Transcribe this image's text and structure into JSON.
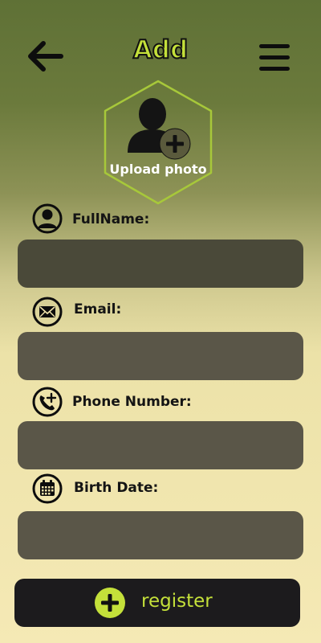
{
  "header": {
    "title": "Add",
    "back_icon": "arrow-left-icon",
    "menu_icon": "hamburger-menu-icon"
  },
  "upload": {
    "label": "Upload photo",
    "icon": "add-user-icon"
  },
  "fields": [
    {
      "label": "FullName:",
      "icon": "user-circle-icon",
      "value": ""
    },
    {
      "label": "Email:",
      "icon": "envelope-icon",
      "value": ""
    },
    {
      "label": "Phone Number:",
      "icon": "phone-plus-icon",
      "value": ""
    },
    {
      "label": "Birth Date:",
      "icon": "calendar-icon",
      "value": ""
    }
  ],
  "register": {
    "label": "register",
    "icon": "plus-circle-icon"
  },
  "colors": {
    "accent": "#c4e03a",
    "input_bg": "#5a5648",
    "button_bg": "#1c1b1d",
    "gradient_top": "#5f7136",
    "gradient_bottom": "#f5e9b5"
  }
}
